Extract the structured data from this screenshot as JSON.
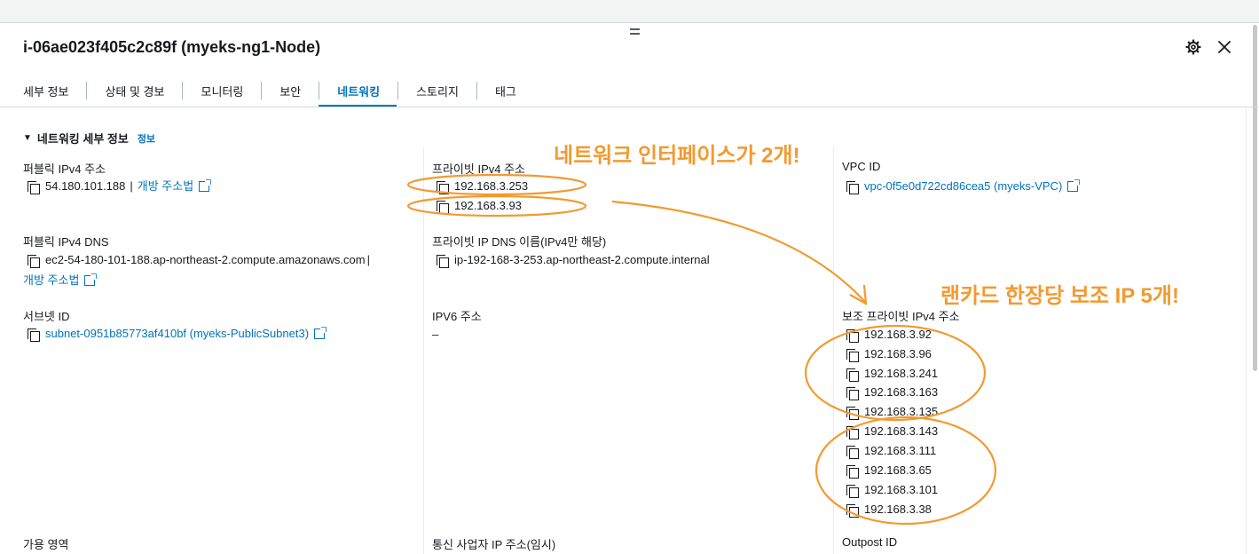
{
  "panel": {
    "title": "i-06ae023f405c2c89f (myeks-ng1-Node)"
  },
  "tabs": [
    {
      "label": "세부 정보"
    },
    {
      "label": "상태 및 경보"
    },
    {
      "label": "모니터링"
    },
    {
      "label": "보안"
    },
    {
      "label": "네트워킹"
    },
    {
      "label": "스토리지"
    },
    {
      "label": "태그"
    }
  ],
  "active_tab": "네트워킹",
  "section": {
    "title": "네트워킹 세부 정보",
    "info_link": "정보"
  },
  "fields": {
    "public_ipv4": {
      "label": "퍼블릭 IPv4 주소",
      "value": "54.180.101.188",
      "separator": "|",
      "open_link": "개방 주소법"
    },
    "private_ipv4": {
      "label": "프라이빗 IPv4 주소",
      "values": [
        "192.168.3.253",
        "192.168.3.93"
      ]
    },
    "vpc_id": {
      "label": "VPC ID",
      "value": "vpc-0f5e0d722cd86cea5 (myeks-VPC)"
    },
    "public_dns": {
      "label": "퍼블릭 IPv4 DNS",
      "value": "ec2-54-180-101-188.ap-northeast-2.compute.amazonaws.com",
      "separator": "|",
      "open_link": "개방 주소법"
    },
    "private_dns": {
      "label": "프라이빗 IP DNS 이름(IPv4만 해당)",
      "value": "ip-192-168-3-253.ap-northeast-2.compute.internal"
    },
    "subnet_id": {
      "label": "서브넷 ID",
      "value": "subnet-0951b85773af410bf (myeks-PublicSubnet3)"
    },
    "ipv6": {
      "label": "IPV6 주소",
      "value": "–"
    },
    "secondary_ipv4": {
      "label": "보조 프라이빗 IPv4 주소",
      "values": [
        "192.168.3.92",
        "192.168.3.96",
        "192.168.3.241",
        "192.168.3.163",
        "192.168.3.135",
        "192.168.3.143",
        "192.168.3.111",
        "192.168.3.65",
        "192.168.3.101",
        "192.168.3.38"
      ]
    },
    "availability_zone": {
      "label": "가용 영역"
    },
    "carrier_ip": {
      "label": "통신 사업자 IP 주소(임시)"
    },
    "outpost_id": {
      "label": "Outpost ID"
    }
  },
  "annotations": {
    "network_interfaces": "네트워크 인터페이스가 2개!",
    "secondary_ips": "랜카드 한장당 보조 IP 5개!",
    "color": "#f29a30"
  },
  "colors": {
    "link": "#0073bb",
    "text": "#16191f"
  },
  "icons": [
    "settings-icon",
    "close-icon",
    "copy-icon",
    "external-link-icon",
    "caret-down-icon"
  ]
}
